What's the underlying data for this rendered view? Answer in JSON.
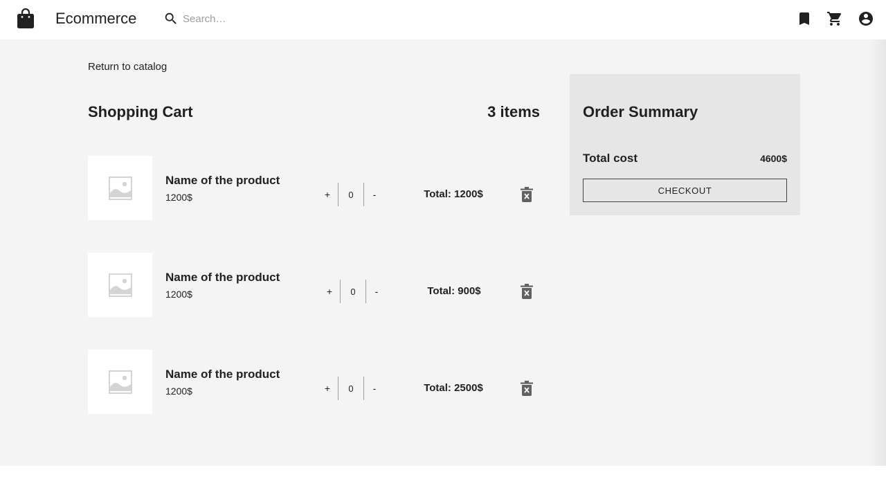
{
  "header": {
    "brand": "Ecommerce",
    "search_placeholder": "Search…",
    "icons": [
      "shopping-bag-icon",
      "search-icon",
      "bookmark-icon",
      "cart-icon",
      "account-circle-icon"
    ]
  },
  "cart": {
    "return_link": "Return to catalog",
    "title": "Shopping Cart",
    "item_count": "3 items",
    "items": [
      {
        "name": "Name of the product",
        "price": "1200$",
        "increment": "+",
        "quantity": "0",
        "decrement": "-",
        "total": "Total: 1200$"
      },
      {
        "name": "Name of the product",
        "price": "1200$",
        "increment": "+",
        "quantity": "0",
        "decrement": "-",
        "total": "Total: 900$"
      },
      {
        "name": "Name of the product",
        "price": "1200$",
        "increment": "+",
        "quantity": "0",
        "decrement": "-",
        "total": "Total: 2500$"
      }
    ]
  },
  "summary": {
    "title": "Order Summary",
    "total_label": "Total cost",
    "total_value": "4600$",
    "checkout_label": "CHECKOUT"
  },
  "colors": {
    "page_background": "#f4f4f4",
    "summary_background": "#e6e6e6",
    "text": "#212121",
    "placeholder_icon": "#d4d4d4"
  }
}
